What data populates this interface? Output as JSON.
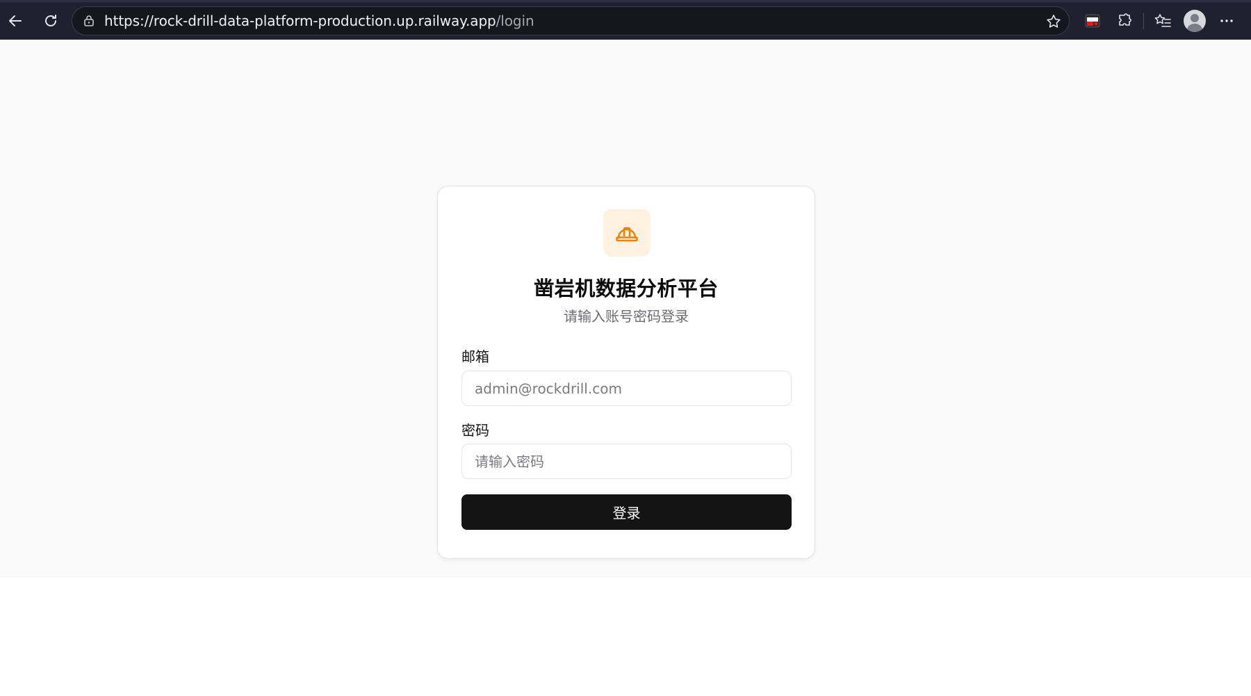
{
  "browser": {
    "url_main": "https://rock-drill-data-platform-production.up.railway.app",
    "url_path": "/login"
  },
  "login": {
    "title": "凿岩机数据分析平台",
    "subtitle": "请输入账号密码登录",
    "email_label": "邮箱",
    "email_placeholder": "admin@rockdrill.com",
    "password_label": "密码",
    "password_placeholder": "请输入密码",
    "submit_label": "登录",
    "logo_icon": "hard-hat-icon",
    "accent_color": "#e8830c"
  }
}
